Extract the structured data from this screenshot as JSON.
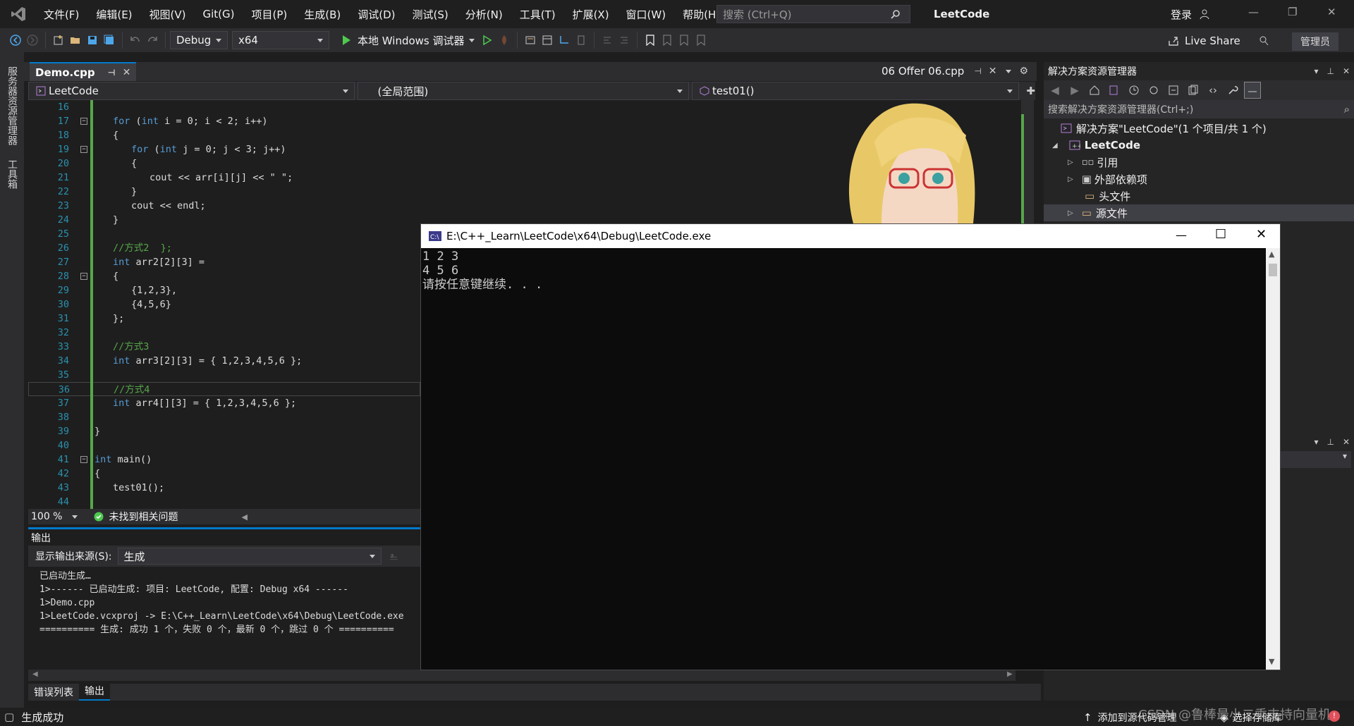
{
  "menu": {
    "items": [
      "文件(F)",
      "编辑(E)",
      "视图(V)",
      "Git(G)",
      "项目(P)",
      "生成(B)",
      "调试(D)",
      "测试(S)",
      "分析(N)",
      "工具(T)",
      "扩展(X)",
      "窗口(W)",
      "帮助(H)"
    ],
    "search_placeholder": "搜索 (Ctrl+Q)",
    "solution_name": "LeetCode",
    "login": "登录"
  },
  "toolbar": {
    "config": "Debug",
    "platform": "x64",
    "run_label": "本地 Windows 调试器",
    "live_share": "Live Share",
    "admin": "管理员"
  },
  "leftstrip": {
    "server_explorer": "服务器资源管理器",
    "toolbox": "工具箱"
  },
  "editor": {
    "active_tab": "Demo.cpp",
    "right_tab": "06 Offer 06.cpp",
    "nav_project": "LeetCode",
    "nav_scope": "(全局范围)",
    "nav_function": "test01()",
    "zoom": "100 %",
    "issues": "未找到相关问题",
    "lines": [
      {
        "n": "16",
        "t": "",
        "c": "tx",
        "indent": 0
      },
      {
        "n": "17",
        "t": "for (int i = 0; i < 2; i++)",
        "c": "tx",
        "indent": 2
      },
      {
        "n": "18",
        "t": "{",
        "c": "tx",
        "indent": 2
      },
      {
        "n": "19",
        "t": "for (int j = 0; j < 3; j++)",
        "c": "tx",
        "indent": 4
      },
      {
        "n": "20",
        "t": "{",
        "c": "tx",
        "indent": 4
      },
      {
        "n": "21",
        "t": "cout << arr[i][j] << \" \";",
        "c": "tx",
        "indent": 6
      },
      {
        "n": "22",
        "t": "}",
        "c": "tx",
        "indent": 4
      },
      {
        "n": "23",
        "t": "cout << endl;",
        "c": "tx",
        "indent": 4
      },
      {
        "n": "24",
        "t": "}",
        "c": "tx",
        "indent": 2
      },
      {
        "n": "25",
        "t": "",
        "c": "tx",
        "indent": 0
      },
      {
        "n": "26",
        "t": "//方式2  };",
        "c": "cm",
        "indent": 2
      },
      {
        "n": "27",
        "t": "int arr2[2][3] =",
        "c": "tx",
        "indent": 2
      },
      {
        "n": "28",
        "t": "{",
        "c": "tx",
        "indent": 2
      },
      {
        "n": "29",
        "t": "{1,2,3},",
        "c": "tx",
        "indent": 4
      },
      {
        "n": "30",
        "t": "{4,5,6}",
        "c": "tx",
        "indent": 4
      },
      {
        "n": "31",
        "t": "};",
        "c": "tx",
        "indent": 2
      },
      {
        "n": "32",
        "t": "",
        "c": "tx",
        "indent": 0
      },
      {
        "n": "33",
        "t": "//方式3",
        "c": "cm",
        "indent": 2
      },
      {
        "n": "34",
        "t": "int arr3[2][3] = { 1,2,3,4,5,6 };",
        "c": "tx",
        "indent": 2
      },
      {
        "n": "35",
        "t": "",
        "c": "tx",
        "indent": 0
      },
      {
        "n": "36",
        "t": "//方式4",
        "c": "cm",
        "indent": 2
      },
      {
        "n": "37",
        "t": "int arr4[][3] = { 1,2,3,4,5,6 };",
        "c": "tx",
        "indent": 2
      },
      {
        "n": "38",
        "t": "",
        "c": "tx",
        "indent": 0
      },
      {
        "n": "39",
        "t": "}",
        "c": "tx",
        "indent": 0
      },
      {
        "n": "40",
        "t": "",
        "c": "tx",
        "indent": 0
      },
      {
        "n": "41",
        "t": "int main()",
        "c": "tx",
        "indent": 0
      },
      {
        "n": "42",
        "t": "{",
        "c": "tx",
        "indent": 0
      },
      {
        "n": "43",
        "t": "test01();",
        "c": "tx",
        "indent": 2
      },
      {
        "n": "44",
        "t": "",
        "c": "tx",
        "indent": 0
      }
    ]
  },
  "output": {
    "title": "输出",
    "source_label": "显示输出来源(S):",
    "source_value": "生成",
    "lines": [
      "已启动生成…",
      "1>------ 已启动生成: 项目: LeetCode, 配置: Debug x64 ------",
      "1>Demo.cpp",
      "1>LeetCode.vcxproj -> E:\\C++_Learn\\LeetCode\\x64\\Debug\\LeetCode.exe",
      "========== 生成: 成功 1 个，失败 0 个，最新 0 个，跳过 0 个 =========="
    ],
    "tab_errors": "错误列表",
    "tab_output": "输出"
  },
  "console": {
    "title": "E:\\C++_Learn\\LeetCode\\x64\\Debug\\LeetCode.exe",
    "lines": [
      "1 2 3",
      "4 5 6",
      "请按任意键继续. . ."
    ]
  },
  "solution_explorer": {
    "title": "解决方案资源管理器",
    "search_placeholder": "搜索解决方案资源管理器(Ctrl+;)",
    "solution": "解决方案\"LeetCode\"(1 个项目/共 1 个)",
    "project": "LeetCode",
    "items": [
      "引用",
      "外部依赖项",
      "头文件",
      "源文件"
    ]
  },
  "statusbar": {
    "build": "生成成功",
    "add_source": "添加到源代码管理",
    "select_repo": "选择存储库",
    "watermark": "CSDN @鲁棒最小二乘支持向量机"
  },
  "colors": {
    "accent": "#007acc",
    "code_green": "#57a64a",
    "keyword": "#569cd6",
    "line_number": "#2b91af"
  }
}
